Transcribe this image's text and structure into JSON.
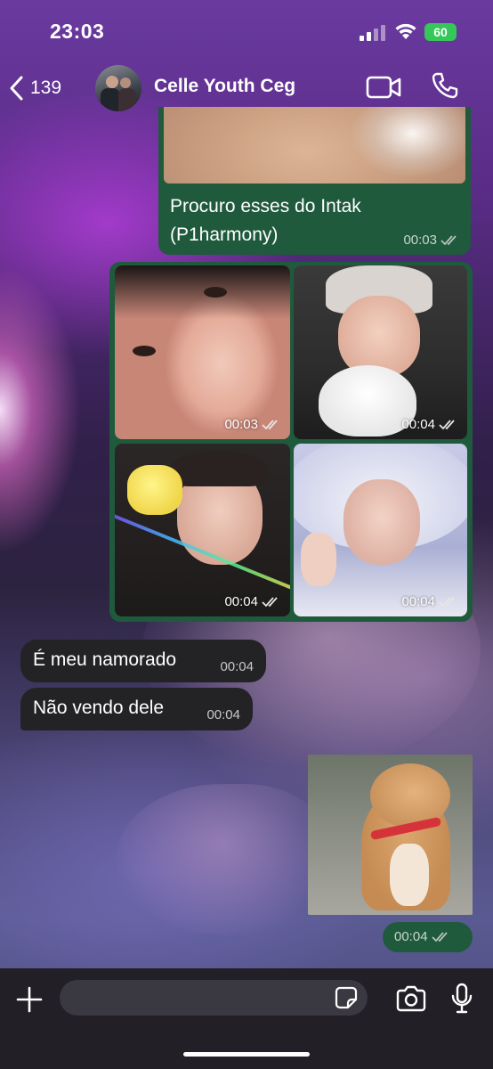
{
  "status_bar": {
    "time": "23:03",
    "battery": "60",
    "battery_color": "#35c759"
  },
  "header": {
    "back_count": "139",
    "chat_name": "Celle Youth Ceg"
  },
  "colors": {
    "outgoing_bubble": "#1f5a3c",
    "incoming_bubble": "#232225",
    "read_ticks": "#b5c4bc"
  },
  "messages": [
    {
      "direction": "outgoing",
      "type": "image_with_caption",
      "caption_line1": "Procuro esses do Intak",
      "caption_line2": "(P1harmony)",
      "time": "00:03",
      "status": "read"
    },
    {
      "direction": "outgoing",
      "type": "photo_album",
      "photos": [
        {
          "time": "00:03",
          "status": "read"
        },
        {
          "time": "00:04",
          "status": "read"
        },
        {
          "time": "00:04",
          "status": "read"
        },
        {
          "time": "00:04",
          "status": "read"
        }
      ]
    },
    {
      "direction": "incoming",
      "type": "text",
      "text": "É meu namorado",
      "time": "00:04"
    },
    {
      "direction": "incoming",
      "type": "text",
      "text": "Não vendo dele",
      "time": "00:04"
    },
    {
      "direction": "outgoing",
      "type": "sticker",
      "time": "00:04",
      "status": "read"
    }
  ],
  "input": {
    "placeholder": ""
  },
  "icons": {
    "back": "chevron-left-icon",
    "video": "video-camera-icon",
    "call": "phone-icon",
    "plus": "plus-icon",
    "sticker": "sticker-icon",
    "camera": "camera-icon",
    "mic": "microphone-icon",
    "ticks": "double-check-icon"
  }
}
